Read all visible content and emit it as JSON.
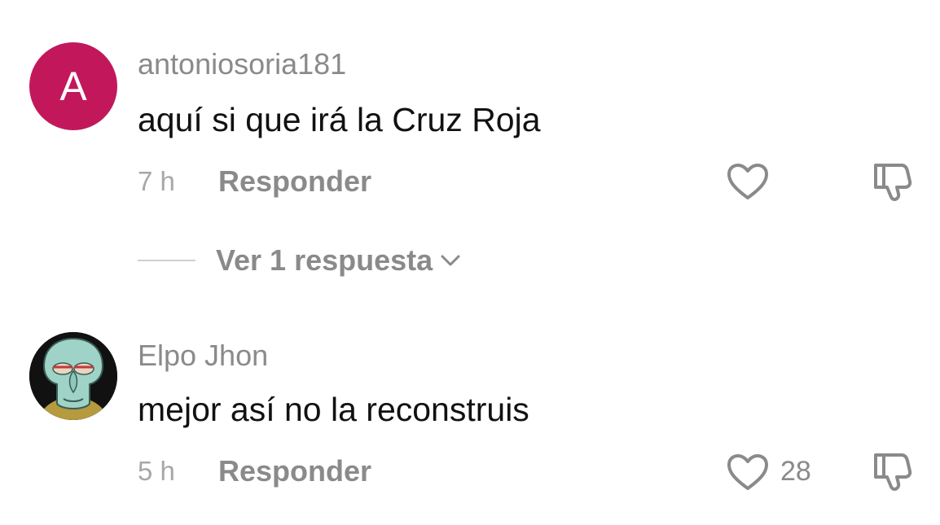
{
  "comments": [
    {
      "avatar_letter": "A",
      "username": "antoniosoria181",
      "text": "aquí si que irá la Cruz Roja",
      "time": "7 h",
      "reply_label": "Responder",
      "view_replies_label": "Ver 1 respuesta",
      "avatar_color": "#c2185b"
    },
    {
      "username": "Elpo Jhon",
      "text": "mejor así no la reconstruis",
      "time": "5 h",
      "reply_label": "Responder",
      "likes": "28"
    }
  ],
  "icons": {
    "like": "heart-icon",
    "dislike": "thumbs-down-icon",
    "expand": "chevron-down-icon"
  }
}
